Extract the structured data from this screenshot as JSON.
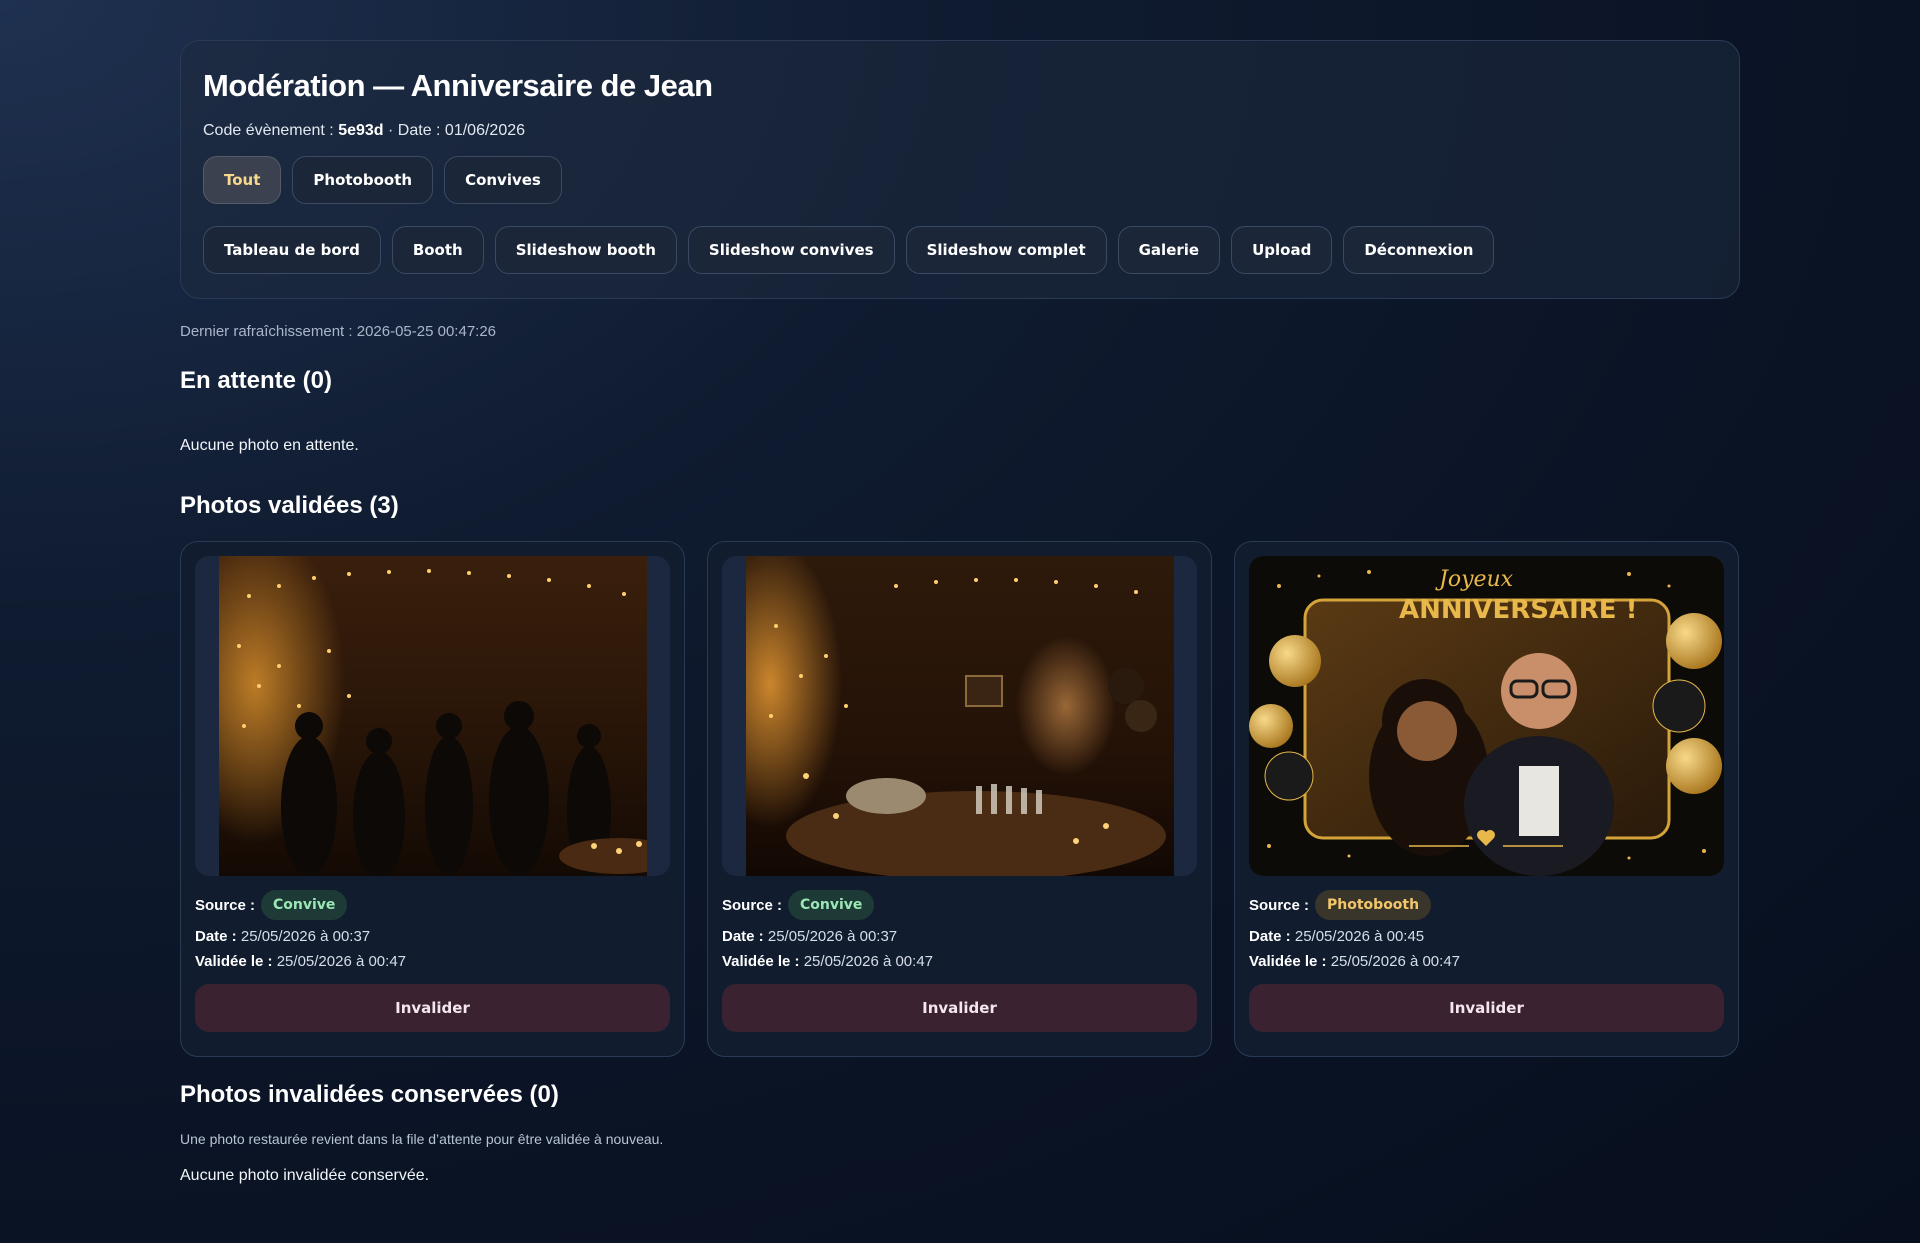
{
  "header": {
    "title": "Modération — Anniversaire de Jean",
    "event_code_label": "Code évènement :",
    "event_code": "5e93d",
    "date_label": " · Date : 01/06/2026",
    "filters": [
      "Tout",
      "Photobooth",
      "Convives"
    ],
    "active_filter": "Tout",
    "nav": [
      "Tableau de bord",
      "Booth",
      "Slideshow booth",
      "Slideshow convives",
      "Slideshow complet",
      "Galerie",
      "Upload",
      "Déconnexion"
    ]
  },
  "refresh_text": "Dernier rafraîchissement : 2026-05-25 00:47:26",
  "pending": {
    "title": "En attente (0)",
    "empty_text": "Aucune photo en attente."
  },
  "validated": {
    "title": "Photos validées (3)",
    "source_label": "Source :",
    "date_label": "Date :",
    "validated_label": "Validée le :",
    "button_label": "Invalider",
    "photos": [
      {
        "source": "Convive",
        "date": "25/05/2026 à 00:37",
        "validated": "25/05/2026 à 00:47",
        "image": "party-guests-photo"
      },
      {
        "source": "Convive",
        "date": "25/05/2026 à 00:37",
        "validated": "25/05/2026 à 00:47",
        "image": "party-buffet-photo"
      },
      {
        "source": "Photobooth",
        "date": "25/05/2026 à 00:45",
        "validated": "25/05/2026 à 00:47",
        "image": "joyeux-anniversaire-frame-photo",
        "frame_text_1": "Joyeux",
        "frame_text_2": "ANNIVERSAIRE !"
      }
    ]
  },
  "kept": {
    "title": "Photos invalidées conservées (0)",
    "hint": "Une photo restaurée revient dans la file d’attente pour être validée à nouveau.",
    "empty_text": "Aucune photo invalidée conservée."
  },
  "colors": {
    "accent_gold": "#f6d98a",
    "convive_badge": "#9be7b6",
    "photobooth_badge": "#f2c76a",
    "invalidate_bg": "#3a2231"
  }
}
